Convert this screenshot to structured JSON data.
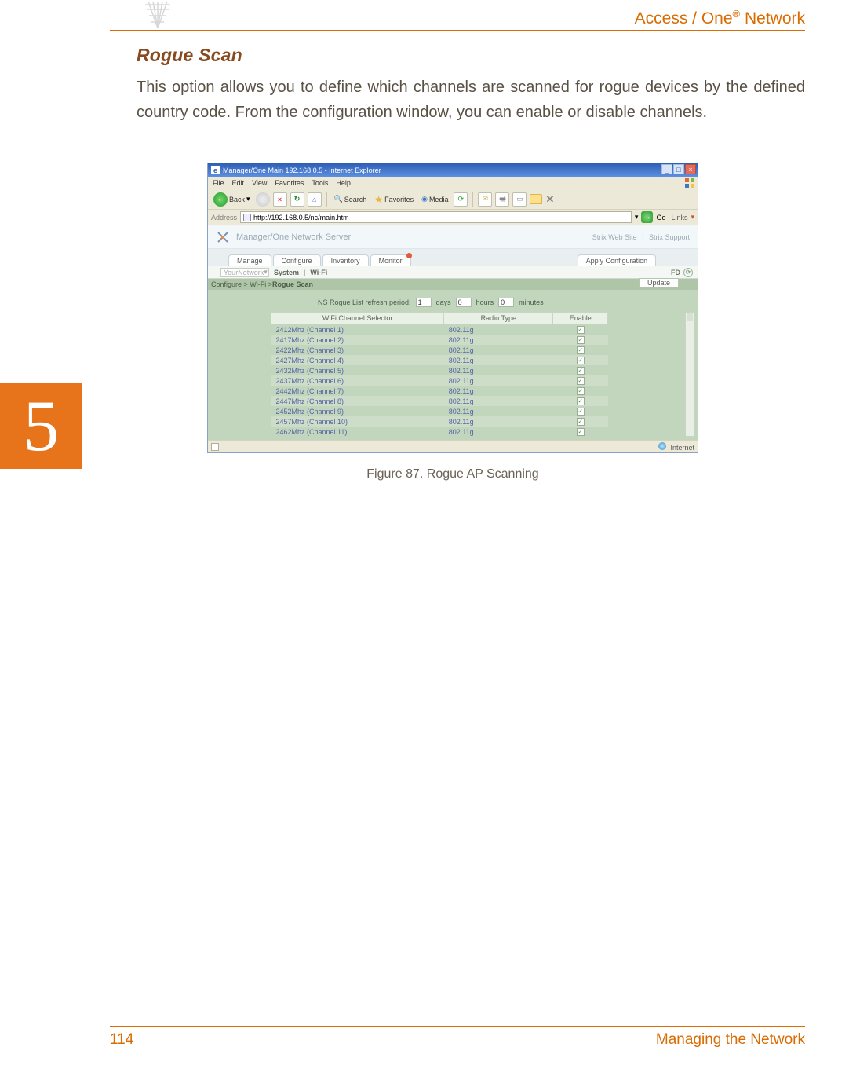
{
  "header": {
    "brand_left": "Access / One",
    "brand_reg": "®",
    "brand_right": " Network"
  },
  "section": {
    "heading": "Rogue Scan",
    "paragraph": "This option allows you to define which channels are scanned for rogue devices by the defined country code. From the configuration window, you can enable or disable channels."
  },
  "chapter": {
    "number": "5"
  },
  "figure": {
    "caption": "Figure 87. Rogue AP Scanning"
  },
  "footer": {
    "page": "114",
    "title": "Managing the Network"
  },
  "ie": {
    "title": "Manager/One Main 192.168.0.5 - Internet Explorer",
    "menu": {
      "file": "File",
      "edit": "Edit",
      "view": "View",
      "favorites": "Favorites",
      "tools": "Tools",
      "help": "Help"
    },
    "toolbar": {
      "back": "Back",
      "search": "Search",
      "favorites": "Favorites",
      "media": "Media"
    },
    "address": {
      "label": "Address",
      "url": "http://192.168.0.5/nc/main.htm",
      "go": "Go",
      "links": "Links"
    },
    "status": {
      "internet": "Internet"
    }
  },
  "app": {
    "title": "Manager/One Network Server",
    "links": {
      "site": "Strix Web Site",
      "support": "Strix Support"
    },
    "tabs": {
      "manage": "Manage",
      "configure": "Configure",
      "inventory": "Inventory",
      "monitor": "Monitor",
      "apply": "Apply Configuration"
    },
    "subtabs": {
      "selector": "YourNetwork",
      "system": "System",
      "wifi": "Wi-Fi",
      "fd": "FD"
    },
    "breadcrumb": {
      "pre": "Configure > Wi-Fi > ",
      "current": "Rogue Scan",
      "update": "Update"
    },
    "refresh": {
      "label": "NS Rogue List refresh period:",
      "days_val": "1",
      "days_lbl": "days",
      "hours_val": "0",
      "hours_lbl": "hours",
      "minutes_val": "0",
      "minutes_lbl": "minutes"
    },
    "table": {
      "h_selector": "WiFi Channel Selector",
      "h_radio": "Radio Type",
      "h_enable": "Enable",
      "rows": [
        {
          "sel": "2412Mhz (Channel 1)",
          "rad": "802.11g",
          "en": true
        },
        {
          "sel": "2417Mhz (Channel 2)",
          "rad": "802.11g",
          "en": true
        },
        {
          "sel": "2422Mhz (Channel 3)",
          "rad": "802.11g",
          "en": true
        },
        {
          "sel": "2427Mhz (Channel 4)",
          "rad": "802.11g",
          "en": true
        },
        {
          "sel": "2432Mhz (Channel 5)",
          "rad": "802.11g",
          "en": true
        },
        {
          "sel": "2437Mhz (Channel 6)",
          "rad": "802.11g",
          "en": true
        },
        {
          "sel": "2442Mhz (Channel 7)",
          "rad": "802.11g",
          "en": true
        },
        {
          "sel": "2447Mhz (Channel 8)",
          "rad": "802.11g",
          "en": true
        },
        {
          "sel": "2452Mhz (Channel 9)",
          "rad": "802.11g",
          "en": true
        },
        {
          "sel": "2457Mhz (Channel 10)",
          "rad": "802.11g",
          "en": true
        },
        {
          "sel": "2462Mhz (Channel 11)",
          "rad": "802.11g",
          "en": true
        }
      ]
    }
  }
}
